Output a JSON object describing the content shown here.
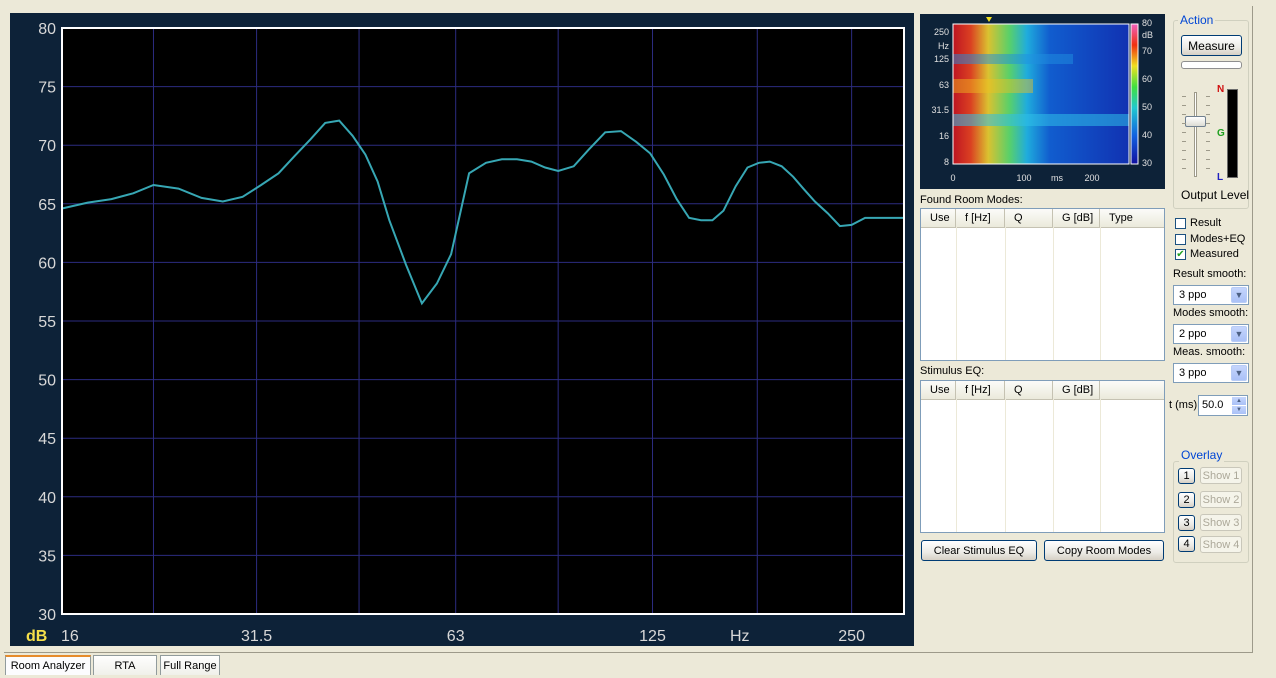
{
  "chart_data": {
    "type": "line",
    "x_scale": "log",
    "x_range": [
      16,
      300
    ],
    "ylim": [
      30,
      80
    ],
    "y_ticks": [
      30,
      35,
      40,
      45,
      50,
      55,
      60,
      65,
      70,
      75,
      80
    ],
    "x_tick_labels": [
      "16",
      "31.5",
      "63",
      "125",
      "250"
    ],
    "x_tick_values": [
      16,
      31.5,
      63,
      125,
      250
    ],
    "x_unit_label": "Hz",
    "y_unit_label": "dB",
    "grid": true,
    "line_color": "#37a7b4",
    "series": [
      {
        "x": [
          16,
          17.5,
          19,
          20.5,
          22,
          24,
          26,
          28,
          30,
          32,
          34,
          36,
          38,
          40,
          42,
          44,
          46,
          48,
          50,
          53,
          56,
          59,
          62,
          66,
          70,
          74,
          78,
          82,
          86,
          90,
          95,
          100,
          106,
          112,
          118,
          124,
          130,
          136,
          142,
          148,
          154,
          160,
          167,
          174,
          181,
          188,
          196,
          204,
          212,
          220,
          230,
          240,
          250,
          262,
          275,
          288,
          300
        ],
        "y": [
          64.6,
          65.1,
          65.4,
          65.9,
          66.6,
          66.3,
          65.5,
          65.2,
          65.6,
          66.6,
          67.6,
          69.1,
          70.5,
          71.9,
          72.1,
          70.8,
          69.2,
          66.9,
          63.6,
          59.8,
          56.5,
          58.2,
          60.7,
          67.6,
          68.5,
          68.8,
          68.8,
          68.6,
          68.1,
          67.8,
          68.2,
          69.6,
          71.1,
          71.2,
          70.3,
          69.3,
          67.5,
          65.4,
          63.8,
          63.6,
          63.6,
          64.4,
          66.5,
          68.1,
          68.5,
          68.6,
          68.2,
          67.3,
          66.2,
          65.2,
          64.2,
          63.1,
          63.2,
          63.8,
          63.8,
          63.8,
          63.8
        ]
      }
    ]
  },
  "spectrogram": {
    "y_labels": [
      "250",
      "Hz",
      "125",
      "63",
      "31.5",
      "16",
      "8"
    ],
    "x_labels": [
      "0",
      "100",
      "ms",
      "200"
    ],
    "scale_labels": [
      "80",
      "dB",
      "70",
      "60",
      "50",
      "40",
      "30"
    ]
  },
  "action": {
    "title": "Action",
    "measure_label": "Measure",
    "output_level_label": "Output Level",
    "meter_labels": [
      "N",
      "G",
      "L"
    ]
  },
  "room_modes": {
    "title": "Found Room Modes:",
    "columns": [
      "Use",
      "f [Hz]",
      "Q",
      "G [dB]",
      "Type"
    ]
  },
  "stimulus_eq": {
    "title": "Stimulus EQ:",
    "columns": [
      "Use",
      "f [Hz]",
      "Q",
      "G [dB]"
    ]
  },
  "buttons": {
    "clear_stimulus_eq": "Clear Stimulus EQ",
    "copy_room_modes": "Copy Room Modes"
  },
  "options": {
    "result_label": "Result",
    "result_checked": false,
    "modes_eq_label": "Modes+EQ",
    "modes_eq_checked": false,
    "measured_label": "Measured",
    "measured_checked": true,
    "result_smooth_label": "Result smooth:",
    "result_smooth_value": "3 ppo",
    "modes_smooth_label": "Modes smooth:",
    "modes_smooth_value": "2 ppo",
    "meas_smooth_label": "Meas. smooth:",
    "meas_smooth_value": "3 ppo",
    "t_ms_label": "t (ms)",
    "t_ms_value": "50.0"
  },
  "overlay": {
    "title": "Overlay",
    "items": [
      {
        "num": "1",
        "show": "Show 1"
      },
      {
        "num": "2",
        "show": "Show 2"
      },
      {
        "num": "3",
        "show": "Show 3"
      },
      {
        "num": "4",
        "show": "Show 4"
      }
    ]
  },
  "tabs": [
    "Room Analyzer",
    "RTA",
    "Full Range"
  ]
}
